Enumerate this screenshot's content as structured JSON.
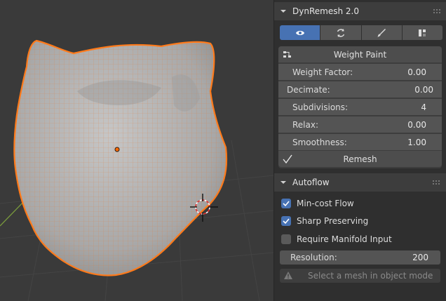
{
  "dynremesh_panel": {
    "title": "DynRemesh 2.0",
    "tabs": [
      {
        "icon": "eye-icon",
        "active": true
      },
      {
        "icon": "refresh-icon",
        "active": false
      },
      {
        "icon": "brush-icon",
        "active": false
      },
      {
        "icon": "pattern-icon",
        "active": false
      }
    ],
    "weight_paint_label": "Weight Paint",
    "weight_factor": {
      "label": "Weight Factor:",
      "value": "0.00"
    },
    "decimate": {
      "label": "Decimate:",
      "value": "0.00"
    },
    "subdivisions": {
      "label": "Subdivisions:",
      "value": "4"
    },
    "relax": {
      "label": "Relax:",
      "value": "0.00"
    },
    "smoothness": {
      "label": "Smoothness:",
      "value": "1.00"
    },
    "remesh_label": "Remesh"
  },
  "autoflow_panel": {
    "title": "Autoflow",
    "min_cost_flow": {
      "label": "Min-cost Flow",
      "checked": true
    },
    "sharp_preserving": {
      "label": "Sharp Preserving",
      "checked": true
    },
    "require_manifold": {
      "label": "Require Manifold Input",
      "checked": false
    },
    "resolution": {
      "label": "Resolution:",
      "value": "200"
    },
    "warning": "Select a mesh in object mode"
  },
  "colors": {
    "accent": "#4772b3",
    "mesh_outline": "#ff7a1a",
    "mesh_fill": "#b9b9b9"
  }
}
